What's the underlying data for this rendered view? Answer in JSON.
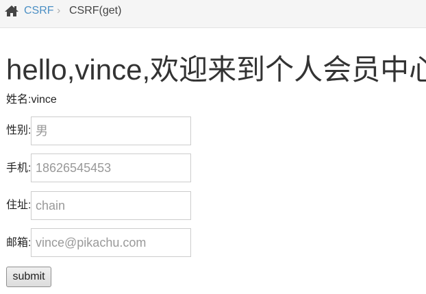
{
  "breadcrumb": {
    "home_icon": "home-icon",
    "link_label": "CSRF",
    "separator": "›",
    "current_label": "CSRF(get)",
    "link_color": "#4b8fc4"
  },
  "main": {
    "title": "hello,vince,欢迎来到个人会员中心",
    "name_line": "姓名:vince",
    "fields": [
      {
        "label": "性别:",
        "placeholder": "男"
      },
      {
        "label": "手机:",
        "placeholder": "18626545453"
      },
      {
        "label": "住址:",
        "placeholder": "chain"
      },
      {
        "label": "邮箱:",
        "placeholder": "vince@pikachu.com"
      }
    ],
    "submit_label": "submit"
  }
}
